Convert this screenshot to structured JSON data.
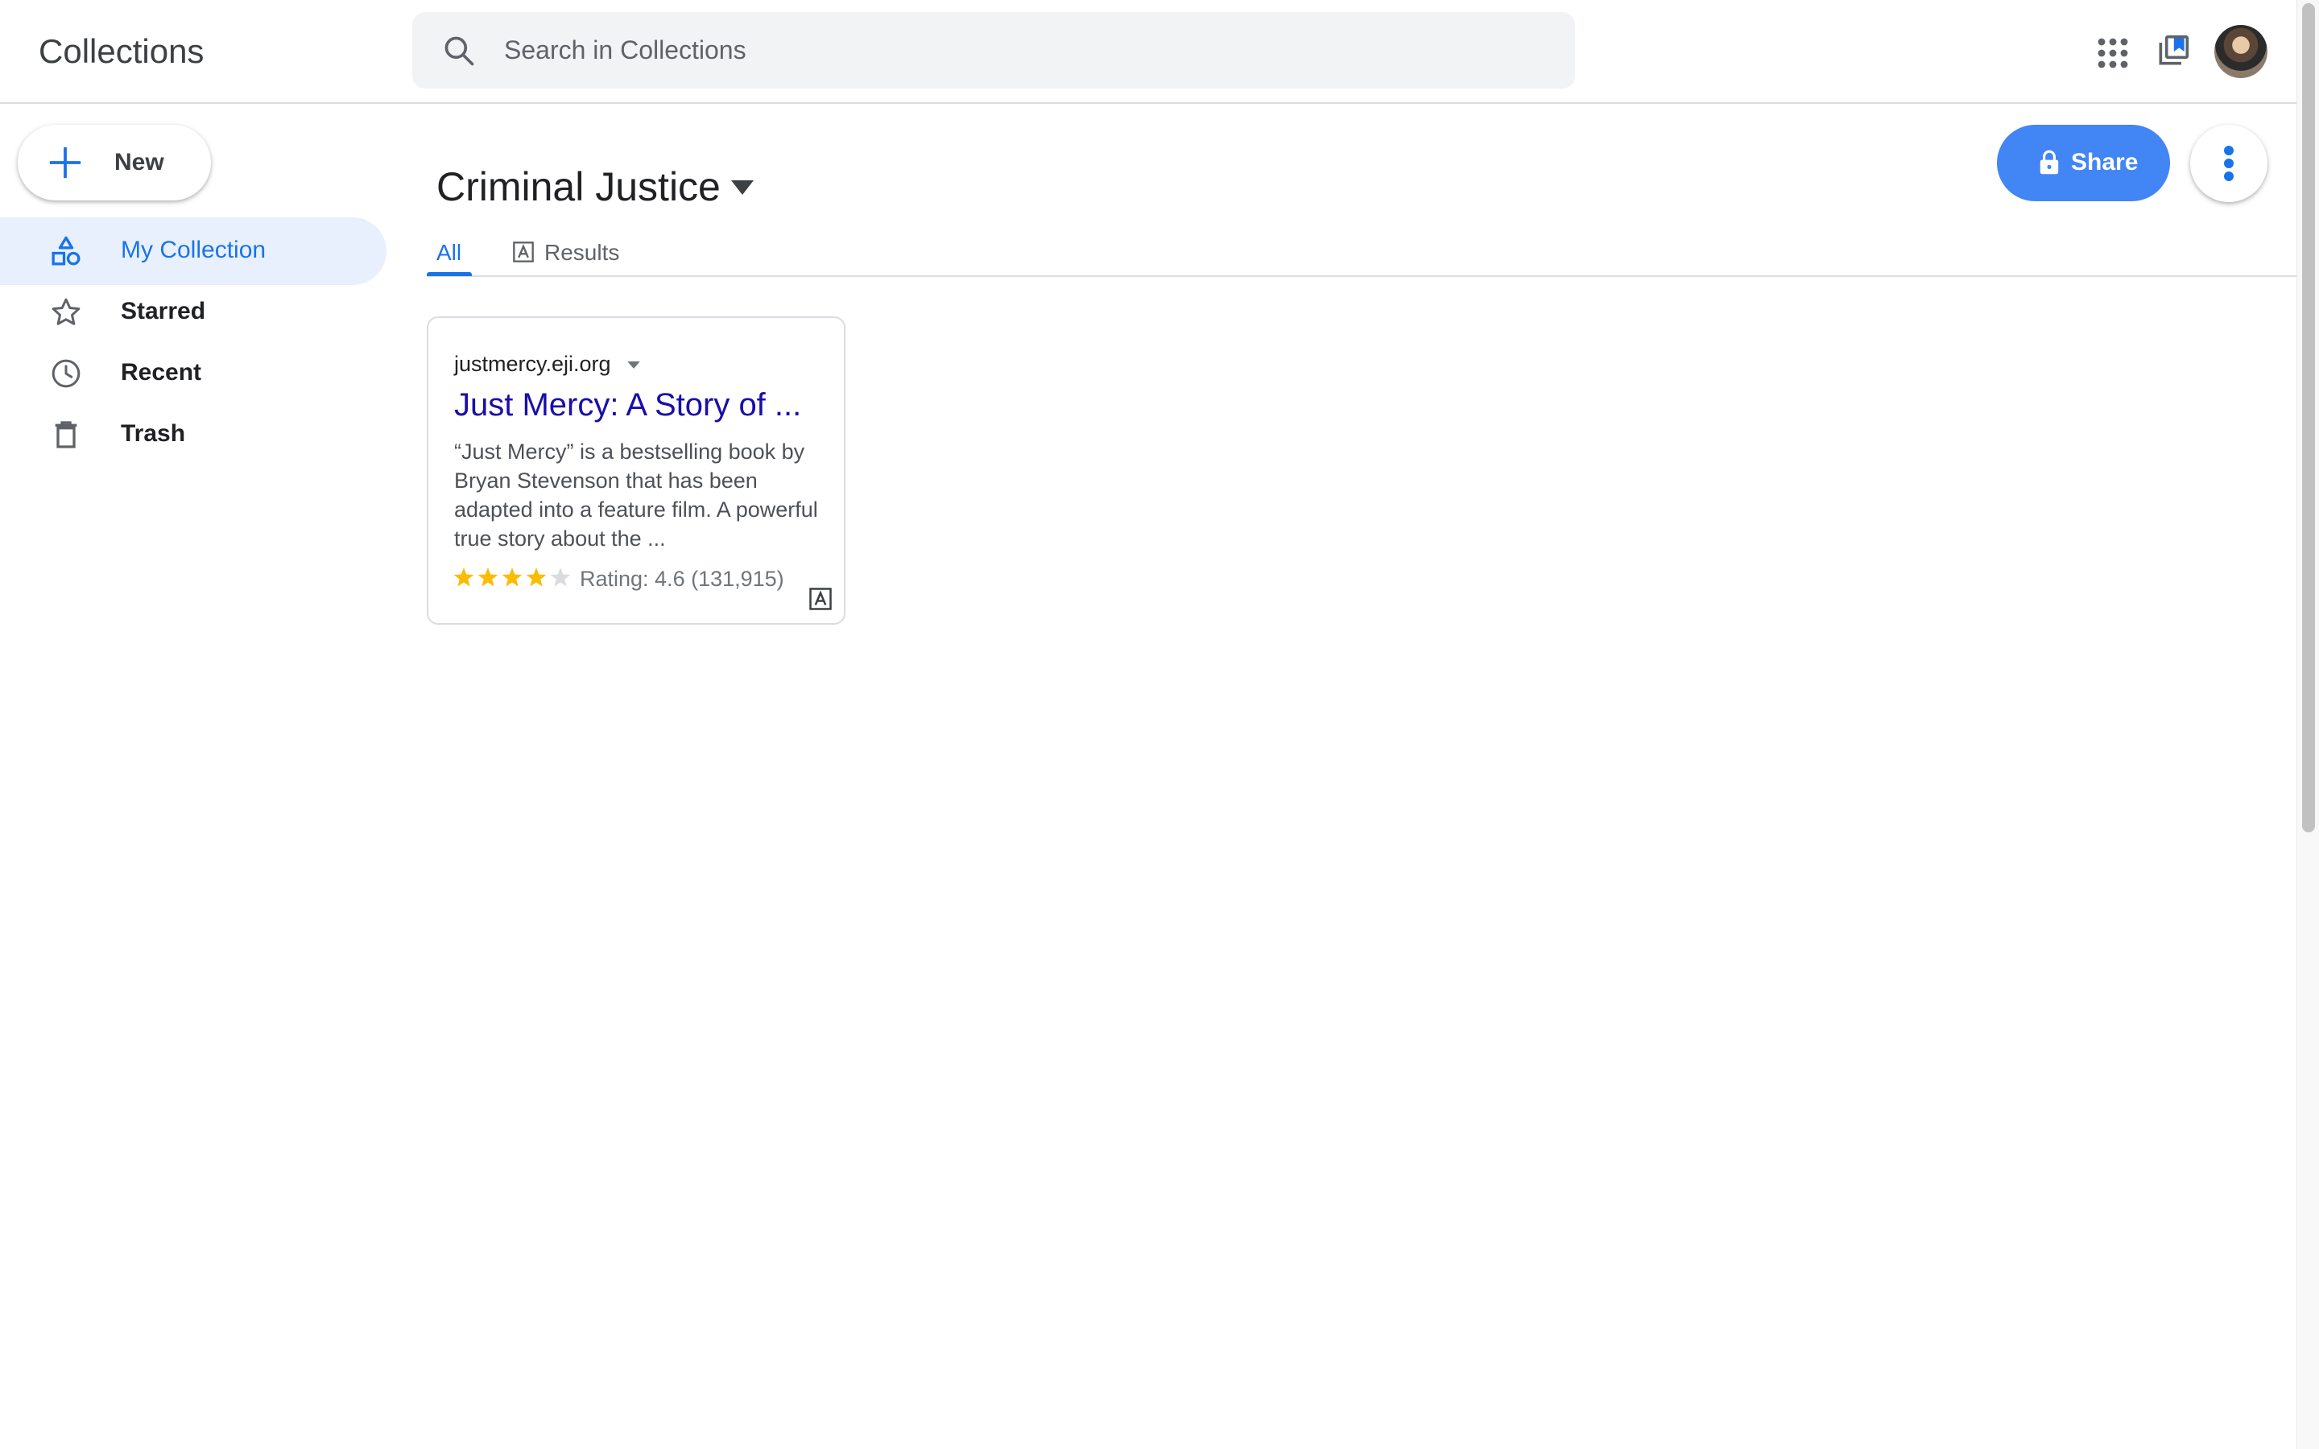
{
  "header": {
    "app_title": "Collections",
    "search_placeholder": "Search in Collections",
    "icons": [
      "search-icon",
      "apps-grid-icon",
      "collections-icon",
      "avatar"
    ]
  },
  "sidebar": {
    "new_label": "New",
    "items": [
      {
        "label": "My Collection",
        "icon": "shapes-icon",
        "active": true
      },
      {
        "label": "Starred",
        "icon": "star-icon",
        "active": false
      },
      {
        "label": "Recent",
        "icon": "clock-icon",
        "active": false
      },
      {
        "label": "Trash",
        "icon": "trash-icon",
        "active": false
      }
    ]
  },
  "main": {
    "collection_title": "Criminal Justice",
    "share_label": "Share",
    "tabs": [
      {
        "label": "All",
        "active": true
      },
      {
        "label": "Results",
        "active": false
      }
    ],
    "cards": [
      {
        "domain": "justmercy.eji.org",
        "title": "Just Mercy: A Story of ...",
        "snippet": "“Just Mercy” is a bestselling book by Bryan Stevenson that has been adapted into a feature film. A powerful true story about the ...",
        "rating_text": "Rating: 4.6 (131,915)",
        "stars_filled": 4,
        "stars_total": 5
      }
    ]
  },
  "colors": {
    "accent": "#1a73e8",
    "share_button": "#4285f4",
    "active_nav_bg": "#e8f0fe",
    "link_title": "#1a0dab",
    "star": "#fbbc04"
  }
}
